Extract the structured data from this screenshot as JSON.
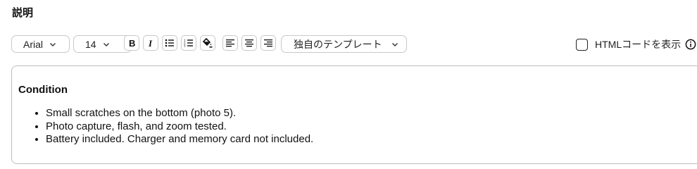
{
  "section": {
    "title": "説明"
  },
  "toolbar": {
    "font_family": "Arial",
    "font_size": "14",
    "template_label": "独自のテンプレート",
    "format_buttons": [
      {
        "name": "bold",
        "icon": "bold-icon"
      },
      {
        "name": "italic",
        "icon": "italic-icon"
      },
      {
        "name": "bullet-list",
        "icon": "bullet-list-icon"
      },
      {
        "name": "numbered-list",
        "icon": "numbered-list-icon"
      },
      {
        "name": "fill-color",
        "icon": "paint-bucket-icon"
      },
      {
        "name": "align-left",
        "icon": "align-left-icon"
      },
      {
        "name": "align-center",
        "icon": "align-center-icon"
      },
      {
        "name": "align-right",
        "icon": "align-right-icon"
      }
    ]
  },
  "html_toggle": {
    "label": "HTMLコードを表示",
    "checked": false,
    "info_icon": "info-icon"
  },
  "editor": {
    "heading": "Condition",
    "items": [
      "Small scratches on the bottom (photo 5).",
      "Photo capture, flash, and zoom tested.",
      "Battery included. Charger and memory card not included."
    ]
  }
}
